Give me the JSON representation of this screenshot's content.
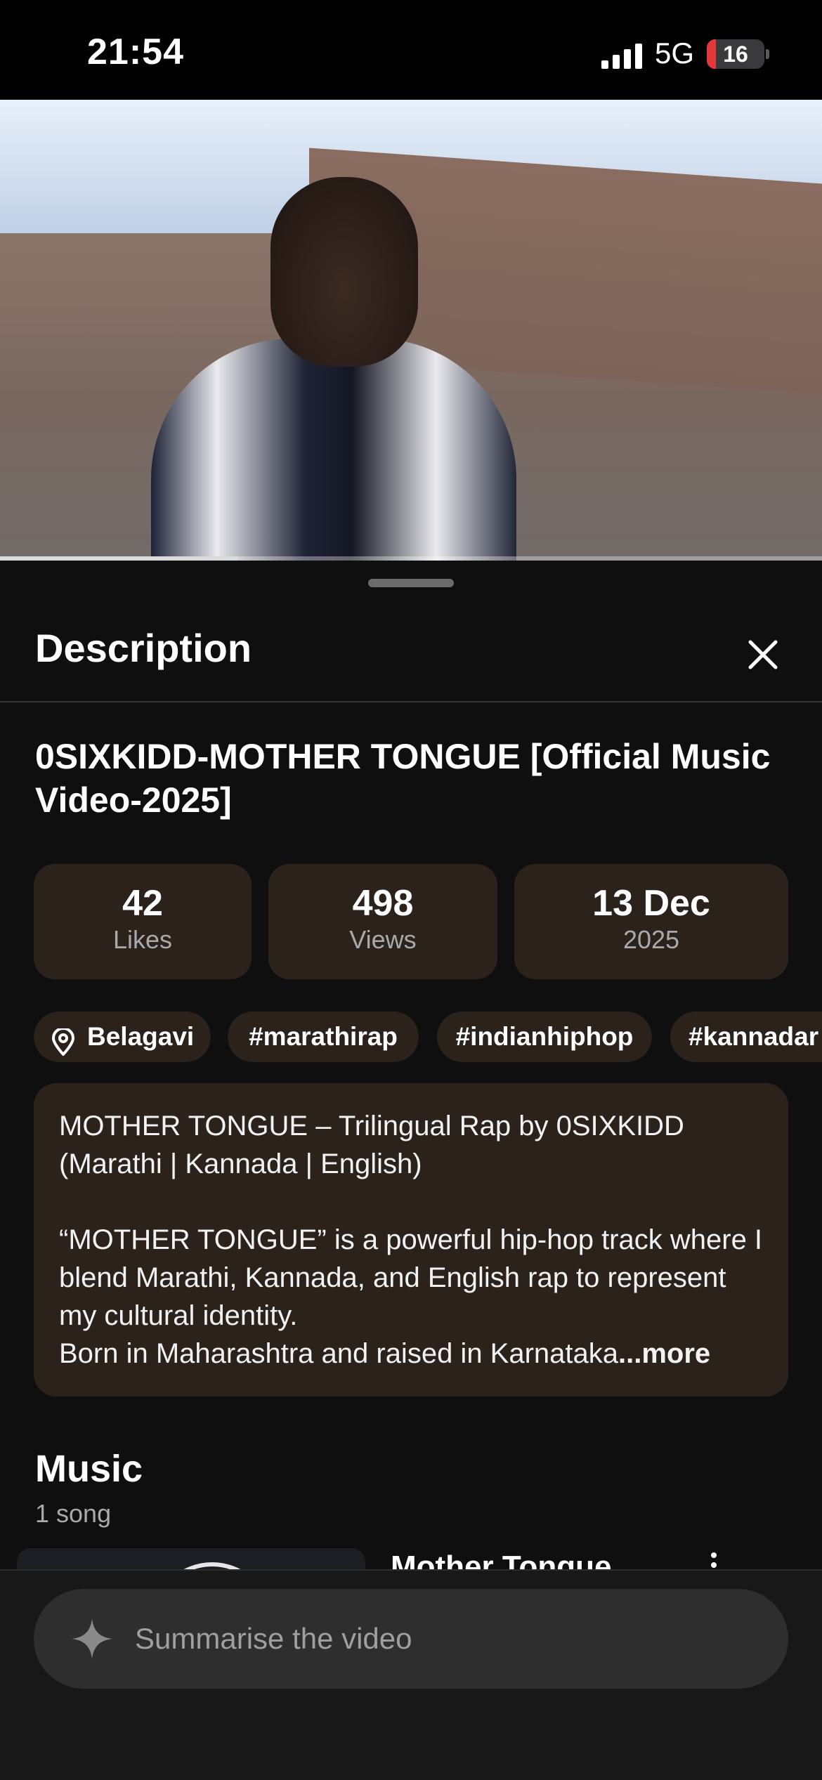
{
  "status_bar": {
    "time": "21:54",
    "network": "5G",
    "battery": "16",
    "battery_fraction": 0.16
  },
  "video": {
    "progress_fraction": 0.29
  },
  "sheet": {
    "title": "Description"
  },
  "video_title": "0SIXKIDD-MOTHER TONGUE [Official Music Video-2025]",
  "stats": [
    {
      "value": "42",
      "label": "Likes"
    },
    {
      "value": "498",
      "label": "Views"
    },
    {
      "value": "13 Dec",
      "label": "2025"
    }
  ],
  "chips": [
    {
      "label": "Belagavi",
      "icon": "location-pin-icon"
    },
    {
      "label": "#marathirap"
    },
    {
      "label": "#indianhiphop"
    },
    {
      "label": "#kannadar"
    }
  ],
  "description": {
    "text": "MOTHER TONGUE – Trilingual Rap by 0SIXKIDD\n(Marathi | Kannada | English)\n\n“MOTHER TONGUE” is a powerful hip-hop track where I blend Marathi, Kannada, and English rap to represent my cultural identity.\nBorn in Maharashtra and raised in Karnataka",
    "more": "...more"
  },
  "music": {
    "title": "Music",
    "subtitle": "1 song",
    "song_title": "Mother Tongue"
  },
  "summarise": {
    "label": "Summarise the video",
    "icon": "sparkle-icon"
  },
  "colors": {
    "background": "#0f0f0f",
    "card": "#2b221c",
    "battery_low": "#e5383b"
  }
}
